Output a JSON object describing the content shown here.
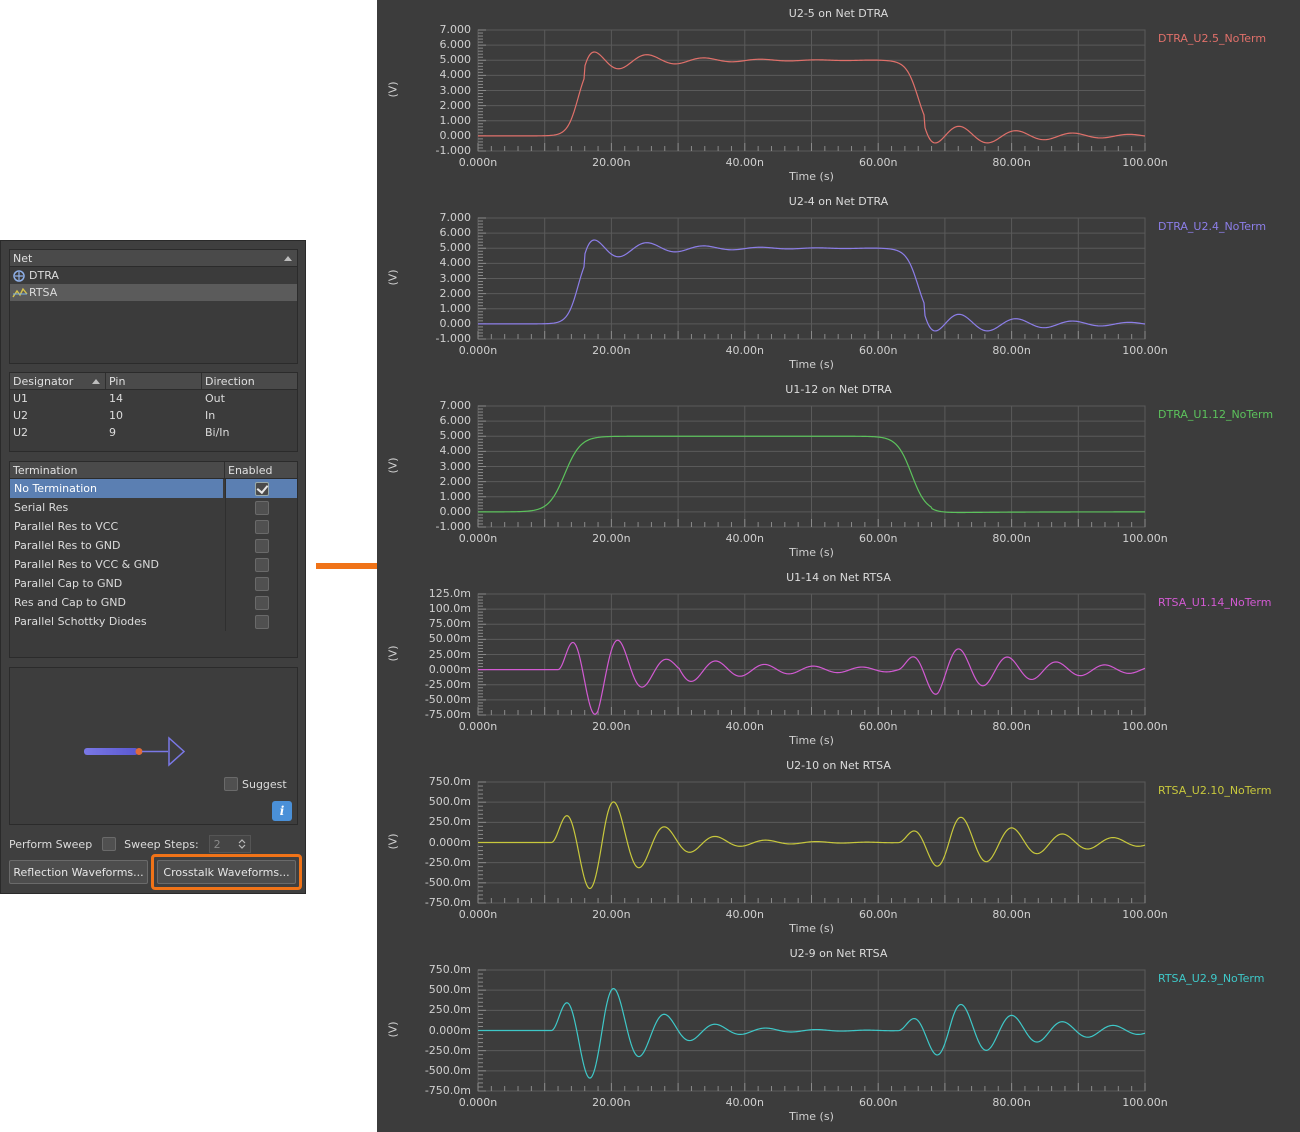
{
  "panel": {
    "net_header": "Net",
    "nets": [
      {
        "label": "DTRA",
        "icon": "net-diff-icon"
      },
      {
        "label": "RTSA",
        "icon": "net-crosstalk-icon"
      }
    ],
    "pins_headers": [
      "Designator",
      "Pin",
      "Direction"
    ],
    "pins": [
      [
        "U1",
        "14",
        "Out"
      ],
      [
        "U2",
        "10",
        "In"
      ],
      [
        "U2",
        "9",
        "Bi/In"
      ]
    ],
    "term_headers": [
      "Termination",
      "Enabled"
    ],
    "terminations": [
      {
        "label": "No Termination",
        "enabled": true
      },
      {
        "label": "Serial Res",
        "enabled": false
      },
      {
        "label": "Parallel Res to VCC",
        "enabled": false
      },
      {
        "label": "Parallel Res to GND",
        "enabled": false
      },
      {
        "label": "Parallel Res to VCC & GND",
        "enabled": false
      },
      {
        "label": "Parallel Cap to GND",
        "enabled": false
      },
      {
        "label": "Res and Cap to GND",
        "enabled": false
      },
      {
        "label": "Parallel Schottky Diodes",
        "enabled": false
      }
    ],
    "suggest_label": "Suggest",
    "perform_sweep_label": "Perform Sweep",
    "sweep_steps_label": "Sweep Steps:",
    "sweep_steps_value": "2",
    "reflection_button": "Reflection Waveforms...",
    "crosstalk_button": "Crosstalk Waveforms...",
    "highlight_color": "#f07318"
  },
  "charts": {
    "unit_label": "(V)",
    "x_title": "Time (s)",
    "x_ticks": [
      "0.000n",
      "20.00n",
      "40.00n",
      "60.00n",
      "80.00n",
      "100.00n"
    ],
    "items": [
      {
        "title": "U2-5 on Net DTRA",
        "legend": "DTRA_U2.5_NoTerm",
        "color": "#e0706a",
        "y_ticks": [
          "7.000",
          "6.000",
          "5.000",
          "4.000",
          "3.000",
          "2.000",
          "1.000",
          "0.000",
          "-1.000"
        ]
      },
      {
        "title": "U2-4 on Net DTRA",
        "legend": "DTRA_U2.4_NoTerm",
        "color": "#8c7ee8",
        "y_ticks": [
          "7.000",
          "6.000",
          "5.000",
          "4.000",
          "3.000",
          "2.000",
          "1.000",
          "0.000",
          "-1.000"
        ]
      },
      {
        "title": "U1-12 on Net DTRA",
        "legend": "DTRA_U1.12_NoTerm",
        "color": "#5cc25c",
        "y_ticks": [
          "7.000",
          "6.000",
          "5.000",
          "4.000",
          "3.000",
          "2.000",
          "1.000",
          "0.000",
          "-1.000"
        ]
      },
      {
        "title": "U1-14 on Net RTSA",
        "legend": "RTSA_U1.14_NoTerm",
        "color": "#d25ad2",
        "y_ticks": [
          "125.0m",
          "100.0m",
          "75.00m",
          "50.00m",
          "25.00m",
          "0.000m",
          "-25.00m",
          "-50.00m",
          "-75.00m"
        ]
      },
      {
        "title": "U2-10 on Net RTSA",
        "legend": "RTSA_U2.10_NoTerm",
        "color": "#c8c83c",
        "y_ticks": [
          "750.0m",
          "500.0m",
          "250.0m",
          "0.000m",
          "-250.0m",
          "-500.0m",
          "-750.0m"
        ]
      },
      {
        "title": "U2-9 on Net RTSA",
        "legend": "RTSA_U2.9_NoTerm",
        "color": "#3ec8c8",
        "y_ticks": [
          "750.0m",
          "500.0m",
          "250.0m",
          "0.000m",
          "-250.0m",
          "-500.0m",
          "-750.0m"
        ]
      }
    ]
  }
}
